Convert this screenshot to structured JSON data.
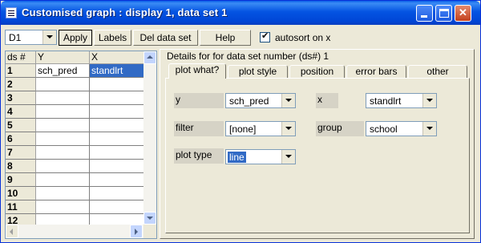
{
  "window": {
    "title": "Customised graph : display  1, data set 1",
    "icon": "graph-window-icon",
    "controls": [
      "minimize-icon",
      "maximize-icon",
      "close-icon"
    ]
  },
  "toolbar": {
    "dataset_select_value": "D1",
    "apply_label": "Apply",
    "labels_label": "Labels",
    "del_data_set_label": "Del data set",
    "help_label": "Help",
    "autosort_label": "autosort on x",
    "autosort_checked": true
  },
  "grid": {
    "headers": [
      "ds #",
      "Y",
      "X"
    ],
    "rows": [
      {
        "ds": "1",
        "y": "sch_pred",
        "x": "standlrt"
      },
      {
        "ds": "2",
        "y": "",
        "x": ""
      },
      {
        "ds": "3",
        "y": "",
        "x": ""
      },
      {
        "ds": "4",
        "y": "",
        "x": ""
      },
      {
        "ds": "5",
        "y": "",
        "x": ""
      },
      {
        "ds": "6",
        "y": "",
        "x": ""
      },
      {
        "ds": "7",
        "y": "",
        "x": ""
      },
      {
        "ds": "8",
        "y": "",
        "x": ""
      },
      {
        "ds": "9",
        "y": "",
        "x": ""
      },
      {
        "ds": "10",
        "y": "",
        "x": ""
      },
      {
        "ds": "11",
        "y": "",
        "x": ""
      },
      {
        "ds": "12",
        "y": "",
        "x": ""
      }
    ],
    "selected_cell": "row 1, column X"
  },
  "details": {
    "legend": "Details for for data set number (ds#) 1",
    "tabs": [
      "plot what?",
      "plot style",
      "position",
      "error bars",
      "other"
    ],
    "active_tab": "plot what?",
    "fields": {
      "y_label": "y",
      "y_value": "sch_pred",
      "x_label": "x",
      "x_value": "standlrt",
      "filter_label": "filter",
      "filter_value": "[none]",
      "group_label": "group",
      "group_value": "school",
      "plot_type_label": "plot type",
      "plot_type_value": "line"
    }
  },
  "colors": {
    "title_bar": "#0454e2",
    "selection": "#316ac5",
    "face": "#ece9d8"
  }
}
